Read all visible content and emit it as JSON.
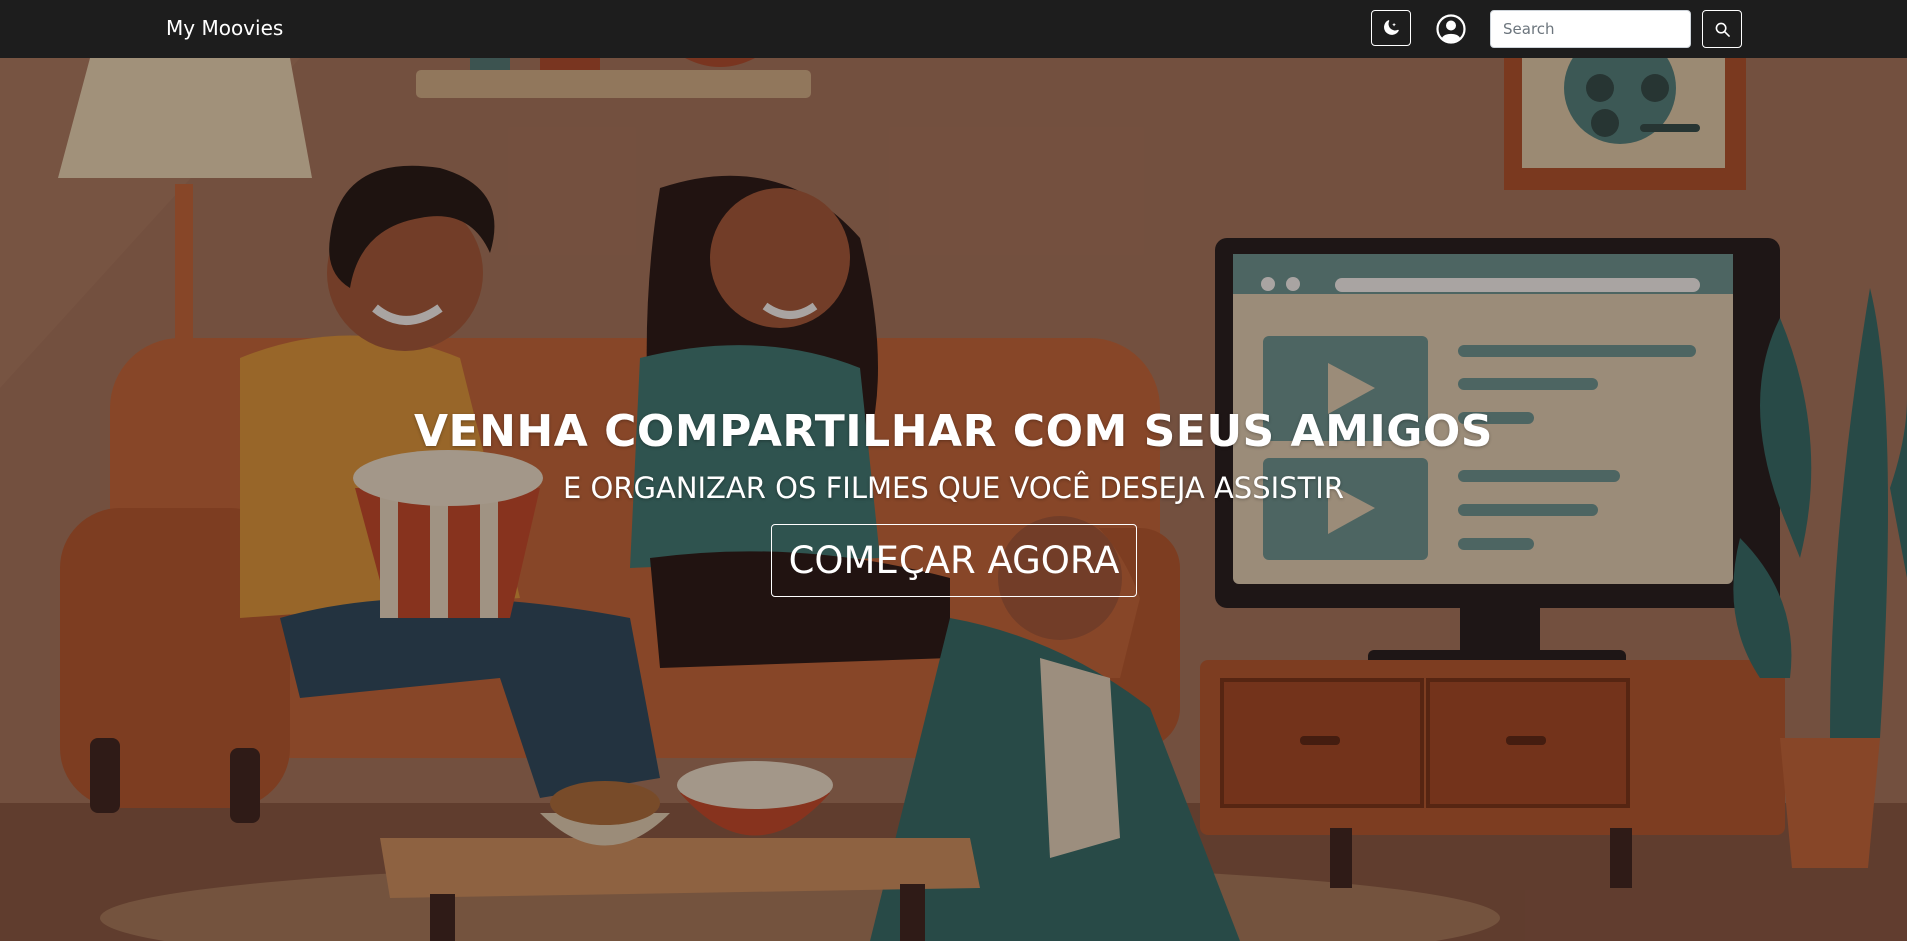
{
  "navbar": {
    "brand": "My Moovies",
    "theme_toggle_icon": "moon-stars-icon",
    "user_icon": "user-circle-icon",
    "search": {
      "placeholder": "Search",
      "value": "",
      "button_icon": "search-icon"
    },
    "background_color": "#1d1d1d"
  },
  "hero": {
    "title": "VENHA COMPARTILHAR COM SEUS AMIGOS",
    "subtitle": "E ORGANIZAR OS FILMES QUE VOCÊ DESEJA ASSISTIR",
    "cta_label": "COMEÇAR AGORA",
    "illustration": "friends-watching-movie-illustration"
  }
}
